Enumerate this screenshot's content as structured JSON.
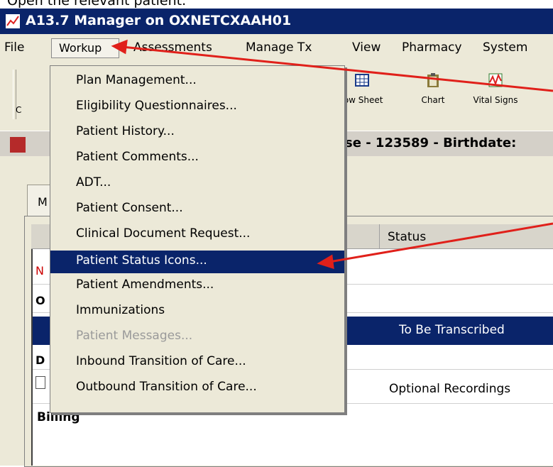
{
  "caption": "Open the relevant patient.",
  "window": {
    "title": "A13.7 Manager on OXNETCXAAH01"
  },
  "menubar": {
    "items": [
      "File",
      "Workup",
      "Assessments",
      "Manage Tx",
      "View",
      "Pharmacy",
      "System"
    ]
  },
  "toolbar": {
    "partial_left": "C",
    "buttons": [
      {
        "label": "low Sheet",
        "icon": "grid-icon"
      },
      {
        "label": "Chart",
        "icon": "clipboard-icon"
      },
      {
        "label": "Vital Signs",
        "icon": "vitals-chart-icon"
      }
    ]
  },
  "patient_bar": {
    "text": "se - 123589 - Birthdate:"
  },
  "tab": {
    "label": "M"
  },
  "grid": {
    "header_status": "Status",
    "left_letters": [
      "N",
      "O",
      "D"
    ],
    "selected_row_status": "To Be Transcribed",
    "row_status_2": "Optional Recordings",
    "billing_label": "Billing"
  },
  "workup_menu": {
    "items": [
      "Plan Management...",
      "Eligibility Questionnaires...",
      "Patient History...",
      "Patient Comments...",
      "ADT...",
      "Patient Consent...",
      "Clinical Document Request...",
      "Patient Status Icons...",
      "Patient Amendments...",
      "Immunizations",
      "Patient Messages...",
      "Inbound Transition of Care...",
      "Outbound Transition of Care..."
    ],
    "selected_index": 7,
    "disabled_index": 10
  },
  "colors": {
    "titlebar": "#0a246a",
    "selection": "#0a246a",
    "annotation_arrow": "#e0201a",
    "chrome": "#ece9d8"
  }
}
